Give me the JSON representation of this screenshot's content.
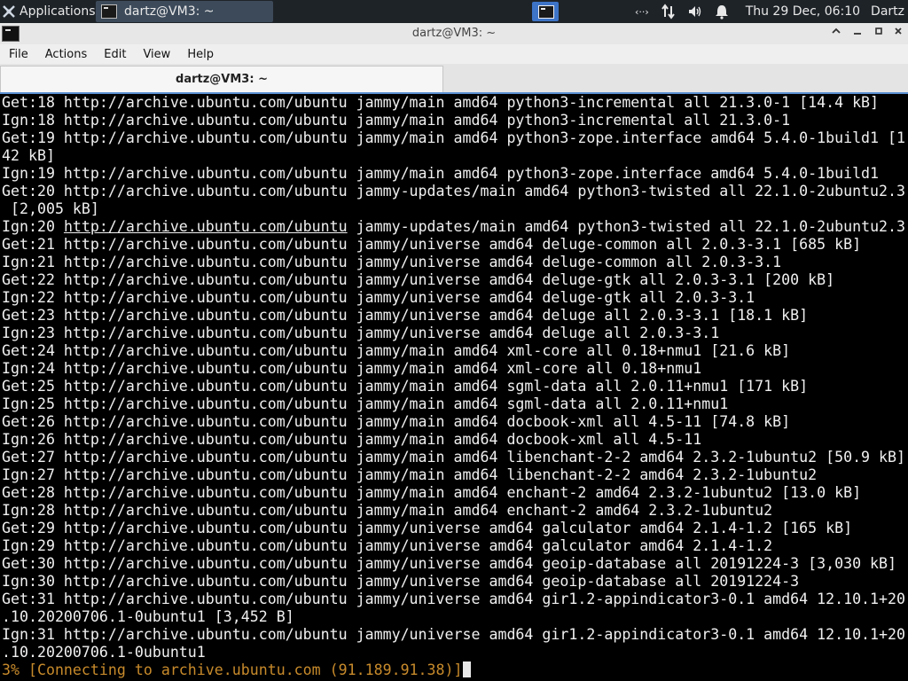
{
  "panel": {
    "applications_label": "Applications",
    "task_title": "dartz@VM3: ~",
    "clock": "Thu 29 Dec, 06:10",
    "user": "Dartz"
  },
  "window": {
    "title": "dartz@VM3: ~",
    "menu": [
      "File",
      "Actions",
      "Edit",
      "View",
      "Help"
    ],
    "tab_label": "dartz@VM3: ~"
  },
  "terminal": {
    "lines": [
      "Get:18 http://archive.ubuntu.com/ubuntu jammy/main amd64 python3-incremental all 21.3.0-1 [14.4 kB]",
      "Ign:18 http://archive.ubuntu.com/ubuntu jammy/main amd64 python3-incremental all 21.3.0-1",
      "Get:19 http://archive.ubuntu.com/ubuntu jammy/main amd64 python3-zope.interface amd64 5.4.0-1build1 [1",
      "42 kB]",
      "Ign:19 http://archive.ubuntu.com/ubuntu jammy/main amd64 python3-zope.interface amd64 5.4.0-1build1",
      "Get:20 http://archive.ubuntu.com/ubuntu jammy-updates/main amd64 python3-twisted all 22.1.0-2ubuntu2.3",
      " [2,005 kB]",
      "Ign:20 http://archive.ubuntu.com/ubuntu jammy-updates/main amd64 python3-twisted all 22.1.0-2ubuntu2.3",
      "Get:21 http://archive.ubuntu.com/ubuntu jammy/universe amd64 deluge-common all 2.0.3-3.1 [685 kB]",
      "Ign:21 http://archive.ubuntu.com/ubuntu jammy/universe amd64 deluge-common all 2.0.3-3.1",
      "Get:22 http://archive.ubuntu.com/ubuntu jammy/universe amd64 deluge-gtk all 2.0.3-3.1 [200 kB]",
      "Ign:22 http://archive.ubuntu.com/ubuntu jammy/universe amd64 deluge-gtk all 2.0.3-3.1",
      "Get:23 http://archive.ubuntu.com/ubuntu jammy/universe amd64 deluge all 2.0.3-3.1 [18.1 kB]",
      "Ign:23 http://archive.ubuntu.com/ubuntu jammy/universe amd64 deluge all 2.0.3-3.1",
      "Get:24 http://archive.ubuntu.com/ubuntu jammy/main amd64 xml-core all 0.18+nmu1 [21.6 kB]",
      "Ign:24 http://archive.ubuntu.com/ubuntu jammy/main amd64 xml-core all 0.18+nmu1",
      "Get:25 http://archive.ubuntu.com/ubuntu jammy/main amd64 sgml-data all 2.0.11+nmu1 [171 kB]",
      "Ign:25 http://archive.ubuntu.com/ubuntu jammy/main amd64 sgml-data all 2.0.11+nmu1",
      "Get:26 http://archive.ubuntu.com/ubuntu jammy/main amd64 docbook-xml all 4.5-11 [74.8 kB]",
      "Ign:26 http://archive.ubuntu.com/ubuntu jammy/main amd64 docbook-xml all 4.5-11",
      "Get:27 http://archive.ubuntu.com/ubuntu jammy/main amd64 libenchant-2-2 amd64 2.3.2-1ubuntu2 [50.9 kB]",
      "Ign:27 http://archive.ubuntu.com/ubuntu jammy/main amd64 libenchant-2-2 amd64 2.3.2-1ubuntu2",
      "Get:28 http://archive.ubuntu.com/ubuntu jammy/main amd64 enchant-2 amd64 2.3.2-1ubuntu2 [13.0 kB]",
      "Ign:28 http://archive.ubuntu.com/ubuntu jammy/main amd64 enchant-2 amd64 2.3.2-1ubuntu2",
      "Get:29 http://archive.ubuntu.com/ubuntu jammy/universe amd64 galculator amd64 2.1.4-1.2 [165 kB]",
      "Ign:29 http://archive.ubuntu.com/ubuntu jammy/universe amd64 galculator amd64 2.1.4-1.2",
      "Get:30 http://archive.ubuntu.com/ubuntu jammy/universe amd64 geoip-database all 20191224-3 [3,030 kB]",
      "Ign:30 http://archive.ubuntu.com/ubuntu jammy/universe amd64 geoip-database all 20191224-3",
      "Get:31 http://archive.ubuntu.com/ubuntu jammy/universe amd64 gir1.2-appindicator3-0.1 amd64 12.10.1+20",
      ".10.20200706.1-0ubuntu1 [3,452 B]",
      "Ign:31 http://archive.ubuntu.com/ubuntu jammy/universe amd64 gir1.2-appindicator3-0.1 amd64 12.10.1+20",
      ".10.20200706.1-0ubuntu1"
    ],
    "underlined_line_index": 7,
    "underlined_text": "http://archive.ubuntu.com/ubuntu",
    "progress_line": "3% [Connecting to archive.ubuntu.com (91.189.91.38)]"
  },
  "icons": {
    "applications": "xfce-mouse-icon",
    "network": "network-arrows-icon",
    "volume": "speaker-icon",
    "notifications": "bell-icon"
  },
  "colors": {
    "panel_bg": "#1e2328",
    "active_workspace": "#3d74c7",
    "progress_text": "#c78a2b"
  }
}
